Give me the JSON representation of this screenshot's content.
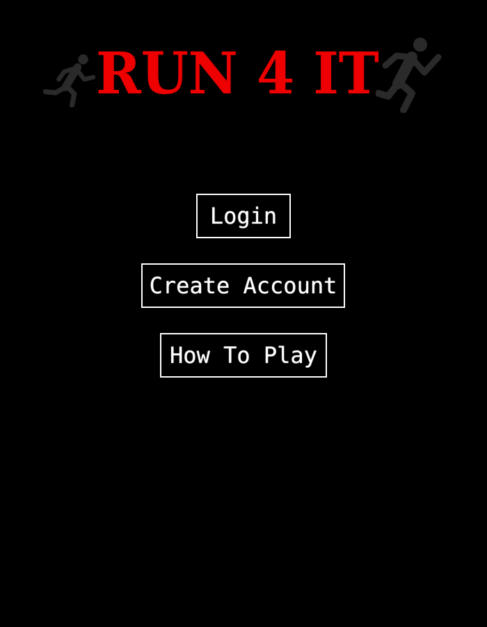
{
  "logo": {
    "text": "RUN 4 IT",
    "left_icon": "running-man-icon",
    "right_icon": "running-man-icon",
    "text_color": "#ee0000",
    "icon_color": "#2a2a2a"
  },
  "menu": {
    "login_label": "Login",
    "create_account_label": "Create Account",
    "how_to_play_label": "How To Play"
  },
  "colors": {
    "background": "#000000",
    "button_border": "#ffffff",
    "button_text": "#ffffff"
  }
}
